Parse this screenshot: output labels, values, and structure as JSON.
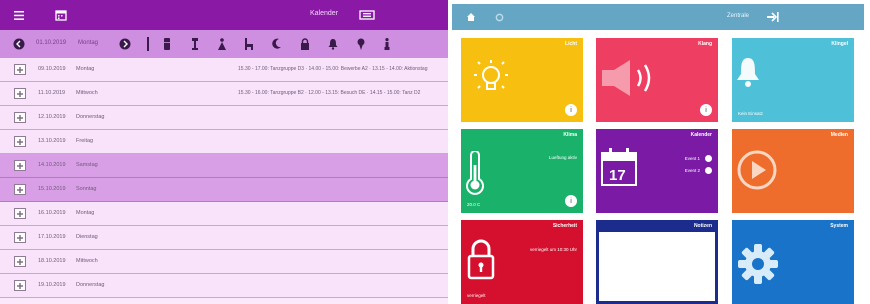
{
  "left": {
    "title": "Kalender",
    "toolbar": {
      "date": "01.10.2019",
      "day": "Montag"
    },
    "rows": [
      {
        "date": "09.10.2019",
        "day": "Montag",
        "info": "15.30 - 17.00: Tanzgruppe D3 · 14.00 - 15.00: Bewerbe A2 · 13.15 - 14.00: Aktionstag",
        "highlight": false
      },
      {
        "date": "11.10.2019",
        "day": "Mittwoch",
        "info": "15.30 - 16.00: Tanzgruppe B2 · 12.00 - 13.15: Besuch DE · 14.15 - 15.00: Tanz D2",
        "highlight": false
      },
      {
        "date": "12.10.2019",
        "day": "Donnerstag",
        "info": "",
        "highlight": false
      },
      {
        "date": "13.10.2019",
        "day": "Freitag",
        "info": "",
        "highlight": false
      },
      {
        "date": "14.10.2019",
        "day": "Samstag",
        "info": "",
        "highlight": true
      },
      {
        "date": "15.10.2019",
        "day": "Sonntag",
        "info": "",
        "highlight": true
      },
      {
        "date": "16.10.2019",
        "day": "Montag",
        "info": "",
        "highlight": false
      },
      {
        "date": "17.10.2019",
        "day": "Dienstag",
        "info": "",
        "highlight": false
      },
      {
        "date": "18.10.2019",
        "day": "Mittwoch",
        "info": "",
        "highlight": false
      },
      {
        "date": "19.10.2019",
        "day": "Donnerstag",
        "info": "",
        "highlight": false
      }
    ],
    "colors": {
      "topbar": "#8a1aa6",
      "toolbar": "#cf8fe0",
      "row": "#f8e3fb",
      "highlight": "#d99fe6"
    }
  },
  "right": {
    "title": "Zentrale",
    "tiles": [
      {
        "id": "licht",
        "label": "Licht",
        "color": "#f7c010",
        "icon": "lightbulb-icon",
        "badge": "i"
      },
      {
        "id": "klang",
        "label": "Klang",
        "color": "#ee3f62",
        "icon": "speaker-icon",
        "badge": "i"
      },
      {
        "id": "klingel",
        "label": "Klingel",
        "color": "#4ec0d7",
        "icon": "bell-icon",
        "sub": "Kein Einsatz"
      },
      {
        "id": "klima",
        "label": "Klima",
        "color": "#1ab16a",
        "icon": "thermometer-icon",
        "sub": "Lueftung aktiv",
        "sub2": "20.0 C",
        "badge": "i"
      },
      {
        "id": "kalender",
        "label": "Kalender",
        "color": "#7a1aa5",
        "icon": "calendar-icon",
        "day": "17",
        "sub": "Event 1",
        "sub2": "Event 2"
      },
      {
        "id": "medien",
        "label": "Medien",
        "color": "#ee6d2c",
        "icon": "play-icon"
      },
      {
        "id": "sicherheit",
        "label": "Sicherheit",
        "color": "#d4102e",
        "icon": "lock-icon",
        "sub": "verriegelt um 10:30 Uhr",
        "sub2": "verriegelt"
      },
      {
        "id": "notizen",
        "label": "Notizen",
        "color": "#1b2c8c",
        "icon": "notes-icon"
      },
      {
        "id": "system",
        "label": "System",
        "color": "#1974c9",
        "icon": "gear-icon"
      }
    ]
  }
}
